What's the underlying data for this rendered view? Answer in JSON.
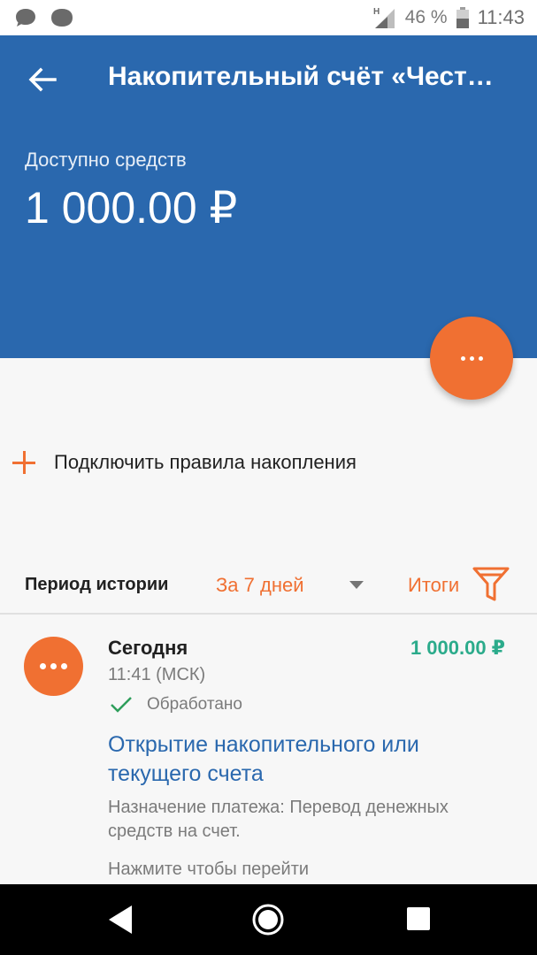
{
  "status_bar": {
    "network_letter": "H",
    "battery": "46 %",
    "time": "11:43",
    "left_icons": [
      "chat-bubble-icon",
      "message-blob-icon"
    ]
  },
  "header": {
    "title": "Накопительный счёт «Чест…",
    "available_label": "Доступно средств",
    "available_amount": "1 000.00 ₽"
  },
  "actions": {
    "connect_rules_label": "Подключить правила накопления"
  },
  "history": {
    "period_label": "Периoд истории",
    "period_value": "За 7 дней",
    "totals_label": "Итоги"
  },
  "transaction": {
    "date": "Сегодня",
    "time": "11:41 (МСК)",
    "status": "Обработано",
    "amount": "1 000.00 ₽",
    "title": "Открытие накопительного или текущего счета",
    "purpose": "Назначение платежа: Перевод денежных средств на счет.",
    "hint": "Нажмите чтобы перейти"
  },
  "colors": {
    "header_blue": "#2a68ae",
    "accent_orange": "#f07032",
    "amount_green": "#2bab8b",
    "link_blue": "#2a68ae"
  }
}
